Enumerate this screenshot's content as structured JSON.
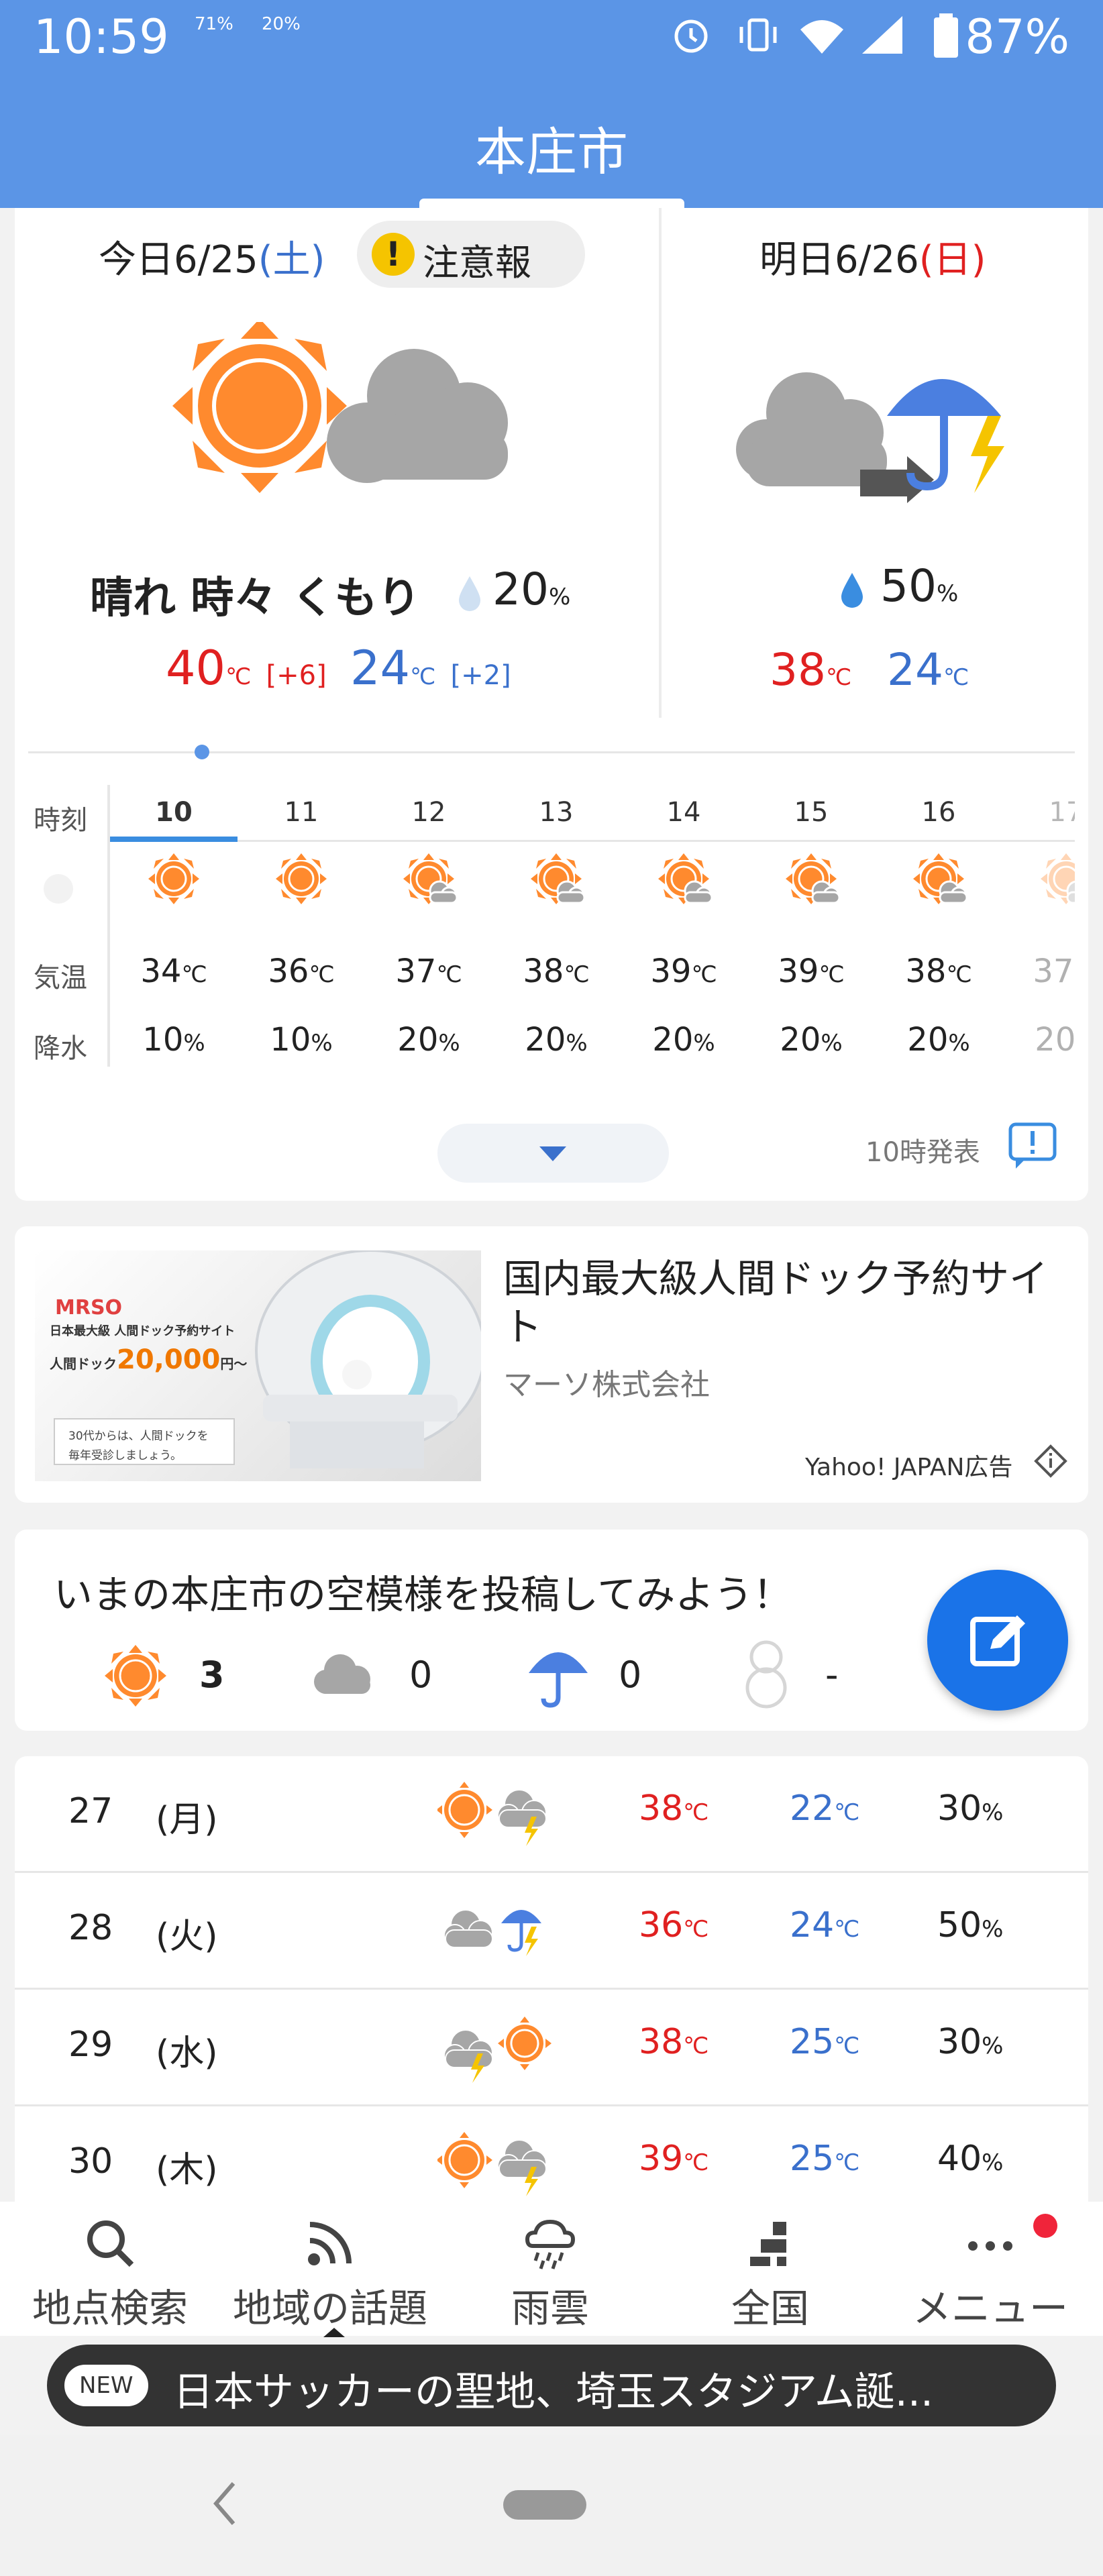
{
  "status_bar": {
    "time": "10:59",
    "indicator_1": "71%",
    "indicator_2": "20%",
    "battery": "87%"
  },
  "header": {
    "title": "本庄市"
  },
  "today": {
    "date_prefix": "今日6/25",
    "dow": "(土)",
    "alert": "注意報",
    "summary": "晴れ 時々 くもり",
    "rain": "20",
    "rain_unit": "%",
    "hi": "40",
    "hi_diff": "[+6]",
    "lo": "24",
    "lo_diff": "[+2]",
    "unit": "℃"
  },
  "tomorrow": {
    "date_prefix": "明日6/26",
    "dow": "(日)",
    "rain": "50",
    "rain_unit": "%",
    "hi": "38",
    "lo": "24",
    "unit": "℃"
  },
  "hourly": {
    "labels": {
      "time": "時刻",
      "temp": "気温",
      "rain": "降水"
    },
    "hours": [
      {
        "hour": "10",
        "temp": "34",
        "rain": "10"
      },
      {
        "hour": "11",
        "temp": "36",
        "rain": "10"
      },
      {
        "hour": "12",
        "temp": "37",
        "rain": "20"
      },
      {
        "hour": "13",
        "temp": "38",
        "rain": "20"
      },
      {
        "hour": "14",
        "temp": "39",
        "rain": "20"
      },
      {
        "hour": "15",
        "temp": "39",
        "rain": "20"
      },
      {
        "hour": "16",
        "temp": "38",
        "rain": "20"
      },
      {
        "hour": "17",
        "temp": "37",
        "rain": "20"
      }
    ],
    "published": "10時発表"
  },
  "ad": {
    "title": "国内最大級人間ドック予約サイト",
    "company": "マーソ株式会社",
    "label": "Yahoo! JAPAN広告",
    "image_text": {
      "brand": "MRSO",
      "line1": "日本最大級 人間ドック予約サイト",
      "line2_prefix": "人間ドック",
      "price": "20,000",
      "price_suffix": "円～",
      "note1": "30代からは、人間ドックを",
      "note2": "毎年受診しましょう。"
    }
  },
  "post": {
    "title": "いまの本庄市の空模様を投稿してみよう！",
    "counts": {
      "sunny": "3",
      "cloudy": "0",
      "rain": "0",
      "snow": "-"
    }
  },
  "weekly": [
    {
      "day": "27",
      "dow": "(月)",
      "hi": "38",
      "lo": "22",
      "rain": "30",
      "icon": "sunny-thunder-icon"
    },
    {
      "day": "28",
      "dow": "(火)",
      "hi": "36",
      "lo": "24",
      "rain": "50",
      "icon": "cloudy-rain-thunder-icon"
    },
    {
      "day": "29",
      "dow": "(水)",
      "hi": "38",
      "lo": "25",
      "rain": "30",
      "icon": "thunder-sunny-icon"
    },
    {
      "day": "30",
      "dow": "(木)",
      "hi": "39",
      "lo": "25",
      "rain": "40",
      "icon": "sunny-thunder-icon"
    }
  ],
  "nav": [
    {
      "label": "地点検索",
      "icon": "search-icon"
    },
    {
      "label": "地域の話題",
      "icon": "feed-icon"
    },
    {
      "label": "雨雲",
      "icon": "rain-cloud-icon"
    },
    {
      "label": "全国",
      "icon": "nationwide-icon"
    },
    {
      "label": "メニュー",
      "icon": "menu-dots-icon"
    }
  ],
  "news": {
    "badge": "NEW",
    "text": "日本サッカーの聖地、埼玉スタジアム誕..."
  },
  "colors": {
    "header": "#5b95e6",
    "sun": "#ff8a2e",
    "cloud": "#a6a6a6",
    "accent": "#1a73e8"
  }
}
